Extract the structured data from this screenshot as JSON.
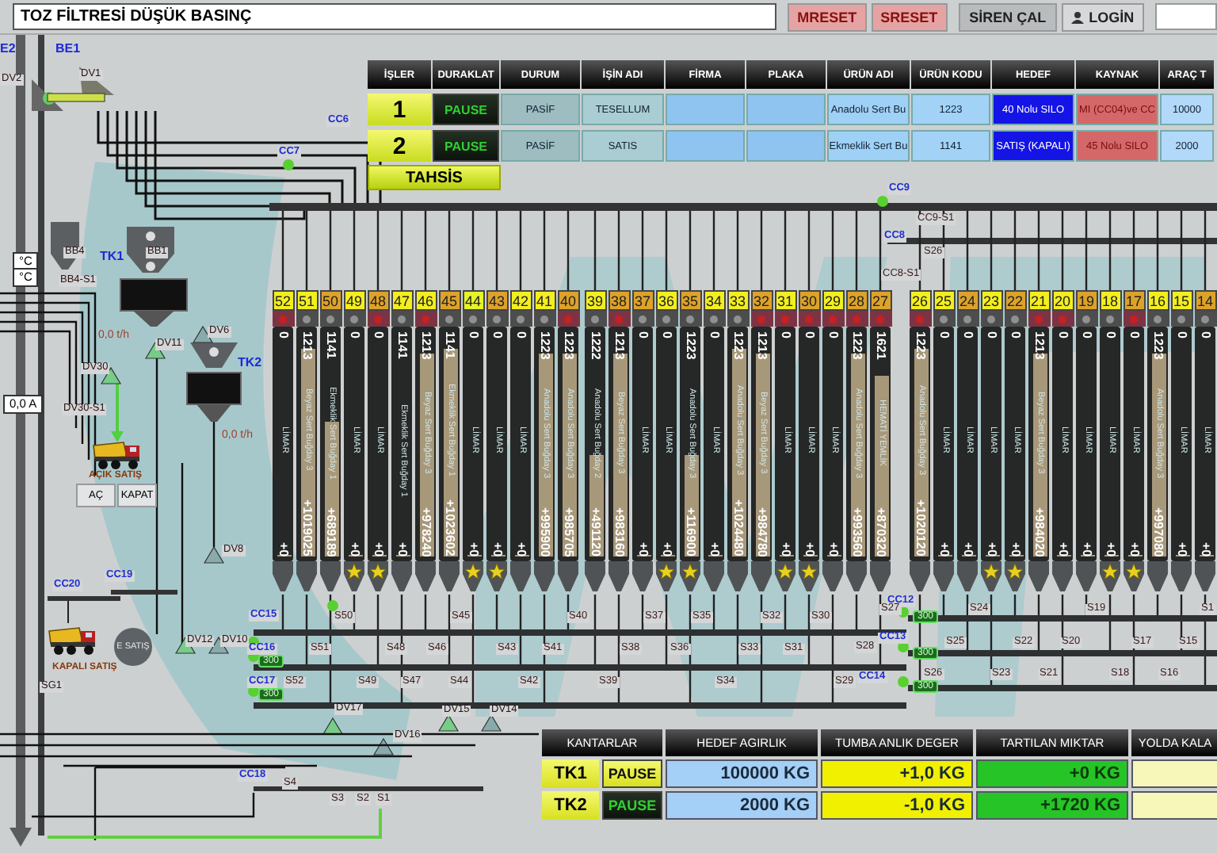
{
  "alarm_message": "TOZ FİLTRESİ DÜŞÜK BASINÇ",
  "top_buttons": [
    {
      "label": "MRESET",
      "kind": "reset"
    },
    {
      "label": "SRESET",
      "kind": "reset"
    },
    {
      "label": "SİREN ÇAL",
      "kind": "siren"
    },
    {
      "label": "LOGİN",
      "kind": "login"
    }
  ],
  "jobs": {
    "columns": [
      {
        "label": "İŞLER",
        "kind": "number"
      },
      {
        "label": "DURAKLAT",
        "kind": "pause"
      },
      {
        "label": "DURUM",
        "kind": "status"
      },
      {
        "label": "İŞİN ADI",
        "kind": "name"
      },
      {
        "label": "FİRMA",
        "kind": "plain"
      },
      {
        "label": "PLAKA",
        "kind": "plain"
      },
      {
        "label": "ÜRÜN ADI",
        "kind": "product"
      },
      {
        "label": "ÜRÜN KODU",
        "kind": "code"
      },
      {
        "label": "HEDEF",
        "kind": "target"
      },
      {
        "label": "KAYNAK",
        "kind": "source"
      },
      {
        "label": "ARAÇ T",
        "kind": "vehicle"
      }
    ],
    "rows": [
      {
        "pause_highlighted": false,
        "cells": [
          "1",
          "PAUSE",
          "PASİF",
          "TESELLUM",
          "",
          "",
          "Anadolu Sert Bu",
          "1223",
          "40 Nolu SILO",
          "MI (CC04)ve CC",
          "10000"
        ]
      },
      {
        "pause_highlighted": false,
        "cells": [
          "2",
          "PAUSE",
          "PASİF",
          "SATIS",
          "",
          "",
          "Ekmeklik Sert Bu",
          "1141",
          "SATIŞ (KAPALI)",
          "45 Nolu SILO",
          "2000"
        ]
      }
    ],
    "assign_button": "TAHSİS"
  },
  "silo_groups": [
    {
      "silos": [
        {
          "number": "52",
          "color": "#f2ee20",
          "alarm": true,
          "code": "0",
          "name": "LİMAR",
          "amount": "+0",
          "level": 0,
          "starred": false
        },
        {
          "number": "51",
          "color": "#f2ee20",
          "alarm": false,
          "code": "1213",
          "name": "Beyaz Sert Buğday 3",
          "amount": "+1019025",
          "level": 0.92,
          "starred": false
        },
        {
          "number": "50",
          "color": "#dca22a",
          "alarm": false,
          "code": "1141",
          "name": "Ekmeklik Sert Buğday 1",
          "amount": "+689189",
          "level": 0.6,
          "starred": false
        },
        {
          "number": "49",
          "color": "#f2ee20",
          "alarm": false,
          "code": "0",
          "name": "LİMAR",
          "amount": "+0",
          "level": 0,
          "starred": true
        },
        {
          "number": "48",
          "color": "#dca22a",
          "alarm": true,
          "code": "0",
          "name": "LİMAR",
          "amount": "+0",
          "level": 0,
          "starred": true
        },
        {
          "number": "47",
          "color": "#f2ee20",
          "alarm": false,
          "code": "1141",
          "name": "Ekmeklik Sert Buğday 1",
          "amount": "+0",
          "level": 0,
          "starred": false
        },
        {
          "number": "46",
          "color": "#f2ee20",
          "alarm": true,
          "code": "1213",
          "name": "Beyaz Sert Buğday 3",
          "amount": "+978240",
          "level": 0.9,
          "starred": false
        },
        {
          "number": "45",
          "color": "#dca22a",
          "alarm": false,
          "code": "1141",
          "name": "Ekmeklik Sert Buğday 1",
          "amount": "+1023602",
          "level": 0.92,
          "starred": false
        },
        {
          "number": "44",
          "color": "#e4f428",
          "alarm": false,
          "code": "0",
          "name": "LİMAR",
          "amount": "+0",
          "level": 0,
          "starred": true
        },
        {
          "number": "43",
          "color": "#dca22a",
          "alarm": false,
          "code": "0",
          "name": "LİMAR",
          "amount": "+0",
          "level": 0,
          "starred": true
        },
        {
          "number": "42",
          "color": "#f2ee20",
          "alarm": false,
          "code": "0",
          "name": "LİMAR",
          "amount": "+0",
          "level": 0,
          "starred": false
        },
        {
          "number": "41",
          "color": "#f2ee20",
          "alarm": false,
          "code": "1223",
          "name": "Anadolu Sert Buğday 3",
          "amount": "+995900",
          "level": 0.9,
          "starred": false
        },
        {
          "number": "40",
          "color": "#dca22a",
          "alarm": true,
          "code": "1223",
          "name": "Anadolu Sert Buğday 3",
          "amount": "+985705",
          "level": 0.9,
          "starred": false
        }
      ]
    },
    {
      "silos": [
        {
          "number": "39",
          "color": "#f2ee20",
          "alarm": false,
          "code": "1222",
          "name": "Anadolu Sert Buğday 2",
          "amount": "+491120",
          "level": 0.45,
          "starred": false
        },
        {
          "number": "38",
          "color": "#dca22a",
          "alarm": true,
          "code": "1213",
          "name": "Beyaz Sert Buğday 3",
          "amount": "+983160",
          "level": 0.9,
          "starred": false
        },
        {
          "number": "37",
          "color": "#dca22a",
          "alarm": false,
          "code": "0",
          "name": "LİMAR",
          "amount": "+0",
          "level": 0,
          "starred": false
        },
        {
          "number": "36",
          "color": "#f2ee20",
          "alarm": false,
          "code": "0",
          "name": "LİMAR",
          "amount": "+0",
          "level": 0,
          "starred": true
        },
        {
          "number": "35",
          "color": "#dca22a",
          "alarm": false,
          "code": "1223",
          "name": "Anadolu Sert Buğday 3",
          "amount": "+116900",
          "level": 0.45,
          "starred": true
        },
        {
          "number": "34",
          "color": "#f2ee20",
          "alarm": false,
          "code": "0",
          "name": "LİMAR",
          "amount": "+0",
          "level": 0,
          "starred": false
        },
        {
          "number": "33",
          "color": "#f2ee20",
          "alarm": false,
          "code": "1223",
          "name": "Anadolu Sert Buğday 3",
          "amount": "+1024480",
          "level": 0.92,
          "starred": false
        },
        {
          "number": "32",
          "color": "#dca22a",
          "alarm": true,
          "code": "1213",
          "name": "Beyaz Sert Buğday 3",
          "amount": "+984780",
          "level": 0.9,
          "starred": false
        },
        {
          "number": "31",
          "color": "#f2ee20",
          "alarm": true,
          "code": "0",
          "name": "LİMAR",
          "amount": "+0",
          "level": 0,
          "starred": true
        },
        {
          "number": "30",
          "color": "#dca22a",
          "alarm": true,
          "code": "0",
          "name": "LİMAR",
          "amount": "+0",
          "level": 0,
          "starred": true
        },
        {
          "number": "29",
          "color": "#f2ee20",
          "alarm": true,
          "code": "0",
          "name": "LİMAR",
          "amount": "+0",
          "level": 0,
          "starred": false
        },
        {
          "number": "28",
          "color": "#dca22a",
          "alarm": true,
          "code": "1223",
          "name": "Anadolu Sert Buğday 3",
          "amount": "+993560",
          "level": 0.9,
          "starred": false
        },
        {
          "number": "27",
          "color": "#dca22a",
          "alarm": true,
          "code": "1621",
          "name": "HEMATİ YEMLİK",
          "amount": "+870320",
          "level": 0.8,
          "starred": false
        }
      ]
    },
    {
      "silos": [
        {
          "number": "26",
          "color": "#f2ee20",
          "alarm": true,
          "code": "1223",
          "name": "Anadolu Sert Buğday 3",
          "amount": "+1020120",
          "level": 0.92,
          "starred": false
        },
        {
          "number": "25",
          "color": "#f2ee20",
          "alarm": false,
          "code": "0",
          "name": "LİMAR",
          "amount": "+0",
          "level": 0,
          "starred": false
        },
        {
          "number": "24",
          "color": "#dca22a",
          "alarm": false,
          "code": "0",
          "name": "LİMAR",
          "amount": "+0",
          "level": 0,
          "starred": false
        },
        {
          "number": "23",
          "color": "#f2ee20",
          "alarm": false,
          "code": "0",
          "name": "LİMAR",
          "amount": "+0",
          "level": 0,
          "starred": true
        },
        {
          "number": "22",
          "color": "#dca22a",
          "alarm": false,
          "code": "0",
          "name": "LİMAR",
          "amount": "+0",
          "level": 0,
          "starred": true
        },
        {
          "number": "21",
          "color": "#f2ee20",
          "alarm": true,
          "code": "1213",
          "name": "Beyaz Sert Buğday 3",
          "amount": "+984020",
          "level": 0.9,
          "starred": false
        },
        {
          "number": "20",
          "color": "#f2ee20",
          "alarm": true,
          "code": "0",
          "name": "LİMAR",
          "amount": "+0",
          "level": 0,
          "starred": false
        },
        {
          "number": "19",
          "color": "#dca22a",
          "alarm": false,
          "code": "0",
          "name": "LİMAR",
          "amount": "+0",
          "level": 0,
          "starred": false
        },
        {
          "number": "18",
          "color": "#f2ee20",
          "alarm": false,
          "code": "0",
          "name": "LİMAR",
          "amount": "+0",
          "level": 0,
          "starred": true
        },
        {
          "number": "17",
          "color": "#dca22a",
          "alarm": true,
          "code": "0",
          "name": "LİMAR",
          "amount": "+0",
          "level": 0,
          "starred": true
        },
        {
          "number": "16",
          "color": "#f2ee20",
          "alarm": false,
          "code": "1223",
          "name": "Anadolu Sert Buğday 3",
          "amount": "+997080",
          "level": 0.9,
          "starred": false
        },
        {
          "number": "15",
          "color": "#f2ee20",
          "alarm": false,
          "code": "0",
          "name": "LİMAR",
          "amount": "+0",
          "level": 0,
          "starred": false
        },
        {
          "number": "14",
          "color": "#dca22a",
          "alarm": false,
          "code": "0",
          "name": "LİMAR",
          "amount": "+0",
          "level": 0,
          "starred": false
        }
      ]
    }
  ],
  "diagram_labels": [
    {
      "text": "E2",
      "kind": "unit"
    },
    {
      "text": "BE1",
      "kind": "unit"
    },
    {
      "text": "TK1",
      "kind": "unit"
    },
    {
      "text": "TK2",
      "kind": "unit"
    },
    {
      "text": "DV2",
      "kind": "device"
    },
    {
      "text": "DV1",
      "kind": "device"
    },
    {
      "text": "BB4",
      "kind": "device"
    },
    {
      "text": "BB1",
      "kind": "device"
    },
    {
      "text": "BB4-S1",
      "kind": "device"
    },
    {
      "text": "DV11",
      "kind": "device"
    },
    {
      "text": "DV6",
      "kind": "device"
    },
    {
      "text": "DV30",
      "kind": "device"
    },
    {
      "text": "DV30-S1",
      "kind": "device"
    },
    {
      "text": "DV8",
      "kind": "device"
    },
    {
      "text": "DV12",
      "kind": "device"
    },
    {
      "text": "DV10",
      "kind": "device"
    },
    {
      "text": "SG1",
      "kind": "device"
    },
    {
      "text": "DV17",
      "kind": "device"
    },
    {
      "text": "DV16",
      "kind": "device"
    },
    {
      "text": "DV15",
      "kind": "device"
    },
    {
      "text": "DV14",
      "kind": "device"
    },
    {
      "text": "0,0 t/h",
      "kind": "reading"
    },
    {
      "text": "0,0 t/h",
      "kind": "reading"
    },
    {
      "text": "CC6",
      "kind": "conveyor"
    },
    {
      "text": "CC7",
      "kind": "conveyor"
    },
    {
      "text": "CC19",
      "kind": "conveyor"
    },
    {
      "text": "CC20",
      "kind": "conveyor"
    },
    {
      "text": "CC15",
      "kind": "conveyor"
    },
    {
      "text": "CC16",
      "kind": "conveyor"
    },
    {
      "text": "CC17",
      "kind": "conveyor"
    },
    {
      "text": "CC18",
      "kind": "conveyor"
    },
    {
      "text": "CC9",
      "kind": "conveyor"
    },
    {
      "text": "CC8",
      "kind": "conveyor"
    },
    {
      "text": "CC12",
      "kind": "conveyor"
    },
    {
      "text": "CC13",
      "kind": "conveyor"
    },
    {
      "text": "CC14",
      "kind": "conveyor"
    },
    {
      "text": "CC9-S1",
      "kind": "sensor"
    },
    {
      "text": "CC8-S1",
      "kind": "sensor"
    },
    {
      "text": "S26",
      "kind": "sensor"
    },
    {
      "text": "AÇIK SATIŞ",
      "kind": "caption"
    },
    {
      "text": "KAPALI SATIŞ",
      "kind": "caption"
    },
    {
      "text": "°C",
      "kind": "readout"
    },
    {
      "text": "°C",
      "kind": "readout"
    },
    {
      "text": "0,0 A",
      "kind": "readout"
    },
    {
      "text": "300",
      "kind": "badge"
    },
    {
      "text": "300",
      "kind": "badge"
    },
    {
      "text": "300",
      "kind": "badge"
    },
    {
      "text": "300",
      "kind": "badge"
    },
    {
      "text": "300",
      "kind": "badge"
    },
    {
      "text": "S50",
      "kind": "sensor"
    },
    {
      "text": "S45",
      "kind": "sensor"
    },
    {
      "text": "S40",
      "kind": "sensor"
    },
    {
      "text": "S37",
      "kind": "sensor"
    },
    {
      "text": "S35",
      "kind": "sensor"
    },
    {
      "text": "S32",
      "kind": "sensor"
    },
    {
      "text": "S30",
      "kind": "sensor"
    },
    {
      "text": "S27",
      "kind": "sensor"
    },
    {
      "text": "S24",
      "kind": "sensor"
    },
    {
      "text": "S19",
      "kind": "sensor"
    },
    {
      "text": "S1",
      "kind": "sensor"
    },
    {
      "text": "S51",
      "kind": "sensor"
    },
    {
      "text": "S48",
      "kind": "sensor"
    },
    {
      "text": "S46",
      "kind": "sensor"
    },
    {
      "text": "S43",
      "kind": "sensor"
    },
    {
      "text": "S41",
      "kind": "sensor"
    },
    {
      "text": "S38",
      "kind": "sensor"
    },
    {
      "text": "S36",
      "kind": "sensor"
    },
    {
      "text": "S33",
      "kind": "sensor"
    },
    {
      "text": "S31",
      "kind": "sensor"
    },
    {
      "text": "S28",
      "kind": "sensor"
    },
    {
      "text": "S25",
      "kind": "sensor"
    },
    {
      "text": "S22",
      "kind": "sensor"
    },
    {
      "text": "S20",
      "kind": "sensor"
    },
    {
      "text": "S17",
      "kind": "sensor"
    },
    {
      "text": "S15",
      "kind": "sensor"
    },
    {
      "text": "S52",
      "kind": "sensor"
    },
    {
      "text": "S49",
      "kind": "sensor"
    },
    {
      "text": "S47",
      "kind": "sensor"
    },
    {
      "text": "S44",
      "kind": "sensor"
    },
    {
      "text": "S42",
      "kind": "sensor"
    },
    {
      "text": "S39",
      "kind": "sensor"
    },
    {
      "text": "S34",
      "kind": "sensor"
    },
    {
      "text": "S29",
      "kind": "sensor"
    },
    {
      "text": "S26",
      "kind": "sensor"
    },
    {
      "text": "S23",
      "kind": "sensor"
    },
    {
      "text": "S21",
      "kind": "sensor"
    },
    {
      "text": "S18",
      "kind": "sensor"
    },
    {
      "text": "S16",
      "kind": "sensor"
    },
    {
      "text": "S4",
      "kind": "sensor"
    },
    {
      "text": "S3",
      "kind": "sensor"
    },
    {
      "text": "S2",
      "kind": "sensor"
    },
    {
      "text": "S1",
      "kind": "sensor"
    }
  ],
  "open_sale_buttons": [
    "AÇ",
    "KAPAT"
  ],
  "closed_sale_button": "E SATIŞ",
  "scales": {
    "header": "KANTARLAR",
    "columns": [
      {
        "label": "HEDEF AGIRLIK",
        "kind": "target"
      },
      {
        "label": "TUMBA ANLIK DEGER",
        "kind": "live"
      },
      {
        "label": "TARTILAN MIKTAR",
        "kind": "weighed"
      },
      {
        "label": "YOLDA KALA",
        "kind": "remaining"
      }
    ],
    "rows": [
      {
        "name": "TK1",
        "pause": {
          "label": "PAUSE",
          "highlighted": true
        },
        "cells": [
          "100000 KG",
          "+1,0 KG",
          "+0 KG",
          ""
        ]
      },
      {
        "name": "TK2",
        "pause": {
          "label": "PAUSE",
          "highlighted": false
        },
        "cells": [
          "2000 KG",
          "-1,0 KG",
          "+1720 KG",
          ""
        ]
      }
    ]
  }
}
